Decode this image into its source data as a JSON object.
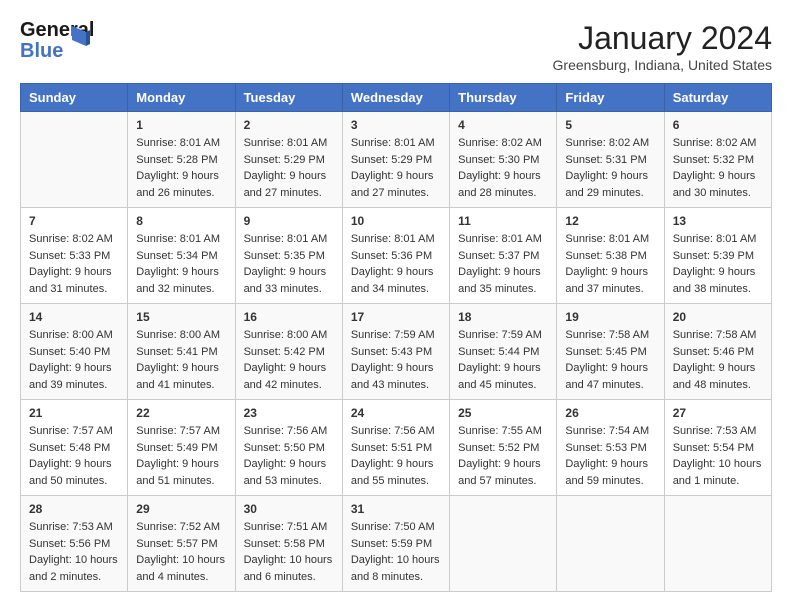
{
  "header": {
    "logo_line1": "General",
    "logo_line2": "Blue",
    "title": "January 2024",
    "subtitle": "Greensburg, Indiana, United States"
  },
  "calendar": {
    "headers": [
      "Sunday",
      "Monday",
      "Tuesday",
      "Wednesday",
      "Thursday",
      "Friday",
      "Saturday"
    ],
    "rows": [
      [
        {
          "day": "",
          "sunrise": "",
          "sunset": "",
          "daylight": ""
        },
        {
          "day": "1",
          "sunrise": "Sunrise: 8:01 AM",
          "sunset": "Sunset: 5:28 PM",
          "daylight": "Daylight: 9 hours and 26 minutes."
        },
        {
          "day": "2",
          "sunrise": "Sunrise: 8:01 AM",
          "sunset": "Sunset: 5:29 PM",
          "daylight": "Daylight: 9 hours and 27 minutes."
        },
        {
          "day": "3",
          "sunrise": "Sunrise: 8:01 AM",
          "sunset": "Sunset: 5:29 PM",
          "daylight": "Daylight: 9 hours and 27 minutes."
        },
        {
          "day": "4",
          "sunrise": "Sunrise: 8:02 AM",
          "sunset": "Sunset: 5:30 PM",
          "daylight": "Daylight: 9 hours and 28 minutes."
        },
        {
          "day": "5",
          "sunrise": "Sunrise: 8:02 AM",
          "sunset": "Sunset: 5:31 PM",
          "daylight": "Daylight: 9 hours and 29 minutes."
        },
        {
          "day": "6",
          "sunrise": "Sunrise: 8:02 AM",
          "sunset": "Sunset: 5:32 PM",
          "daylight": "Daylight: 9 hours and 30 minutes."
        }
      ],
      [
        {
          "day": "7",
          "sunrise": "Sunrise: 8:02 AM",
          "sunset": "Sunset: 5:33 PM",
          "daylight": "Daylight: 9 hours and 31 minutes."
        },
        {
          "day": "8",
          "sunrise": "Sunrise: 8:01 AM",
          "sunset": "Sunset: 5:34 PM",
          "daylight": "Daylight: 9 hours and 32 minutes."
        },
        {
          "day": "9",
          "sunrise": "Sunrise: 8:01 AM",
          "sunset": "Sunset: 5:35 PM",
          "daylight": "Daylight: 9 hours and 33 minutes."
        },
        {
          "day": "10",
          "sunrise": "Sunrise: 8:01 AM",
          "sunset": "Sunset: 5:36 PM",
          "daylight": "Daylight: 9 hours and 34 minutes."
        },
        {
          "day": "11",
          "sunrise": "Sunrise: 8:01 AM",
          "sunset": "Sunset: 5:37 PM",
          "daylight": "Daylight: 9 hours and 35 minutes."
        },
        {
          "day": "12",
          "sunrise": "Sunrise: 8:01 AM",
          "sunset": "Sunset: 5:38 PM",
          "daylight": "Daylight: 9 hours and 37 minutes."
        },
        {
          "day": "13",
          "sunrise": "Sunrise: 8:01 AM",
          "sunset": "Sunset: 5:39 PM",
          "daylight": "Daylight: 9 hours and 38 minutes."
        }
      ],
      [
        {
          "day": "14",
          "sunrise": "Sunrise: 8:00 AM",
          "sunset": "Sunset: 5:40 PM",
          "daylight": "Daylight: 9 hours and 39 minutes."
        },
        {
          "day": "15",
          "sunrise": "Sunrise: 8:00 AM",
          "sunset": "Sunset: 5:41 PM",
          "daylight": "Daylight: 9 hours and 41 minutes."
        },
        {
          "day": "16",
          "sunrise": "Sunrise: 8:00 AM",
          "sunset": "Sunset: 5:42 PM",
          "daylight": "Daylight: 9 hours and 42 minutes."
        },
        {
          "day": "17",
          "sunrise": "Sunrise: 7:59 AM",
          "sunset": "Sunset: 5:43 PM",
          "daylight": "Daylight: 9 hours and 43 minutes."
        },
        {
          "day": "18",
          "sunrise": "Sunrise: 7:59 AM",
          "sunset": "Sunset: 5:44 PM",
          "daylight": "Daylight: 9 hours and 45 minutes."
        },
        {
          "day": "19",
          "sunrise": "Sunrise: 7:58 AM",
          "sunset": "Sunset: 5:45 PM",
          "daylight": "Daylight: 9 hours and 47 minutes."
        },
        {
          "day": "20",
          "sunrise": "Sunrise: 7:58 AM",
          "sunset": "Sunset: 5:46 PM",
          "daylight": "Daylight: 9 hours and 48 minutes."
        }
      ],
      [
        {
          "day": "21",
          "sunrise": "Sunrise: 7:57 AM",
          "sunset": "Sunset: 5:48 PM",
          "daylight": "Daylight: 9 hours and 50 minutes."
        },
        {
          "day": "22",
          "sunrise": "Sunrise: 7:57 AM",
          "sunset": "Sunset: 5:49 PM",
          "daylight": "Daylight: 9 hours and 51 minutes."
        },
        {
          "day": "23",
          "sunrise": "Sunrise: 7:56 AM",
          "sunset": "Sunset: 5:50 PM",
          "daylight": "Daylight: 9 hours and 53 minutes."
        },
        {
          "day": "24",
          "sunrise": "Sunrise: 7:56 AM",
          "sunset": "Sunset: 5:51 PM",
          "daylight": "Daylight: 9 hours and 55 minutes."
        },
        {
          "day": "25",
          "sunrise": "Sunrise: 7:55 AM",
          "sunset": "Sunset: 5:52 PM",
          "daylight": "Daylight: 9 hours and 57 minutes."
        },
        {
          "day": "26",
          "sunrise": "Sunrise: 7:54 AM",
          "sunset": "Sunset: 5:53 PM",
          "daylight": "Daylight: 9 hours and 59 minutes."
        },
        {
          "day": "27",
          "sunrise": "Sunrise: 7:53 AM",
          "sunset": "Sunset: 5:54 PM",
          "daylight": "Daylight: 10 hours and 1 minute."
        }
      ],
      [
        {
          "day": "28",
          "sunrise": "Sunrise: 7:53 AM",
          "sunset": "Sunset: 5:56 PM",
          "daylight": "Daylight: 10 hours and 2 minutes."
        },
        {
          "day": "29",
          "sunrise": "Sunrise: 7:52 AM",
          "sunset": "Sunset: 5:57 PM",
          "daylight": "Daylight: 10 hours and 4 minutes."
        },
        {
          "day": "30",
          "sunrise": "Sunrise: 7:51 AM",
          "sunset": "Sunset: 5:58 PM",
          "daylight": "Daylight: 10 hours and 6 minutes."
        },
        {
          "day": "31",
          "sunrise": "Sunrise: 7:50 AM",
          "sunset": "Sunset: 5:59 PM",
          "daylight": "Daylight: 10 hours and 8 minutes."
        },
        {
          "day": "",
          "sunrise": "",
          "sunset": "",
          "daylight": ""
        },
        {
          "day": "",
          "sunrise": "",
          "sunset": "",
          "daylight": ""
        },
        {
          "day": "",
          "sunrise": "",
          "sunset": "",
          "daylight": ""
        }
      ]
    ]
  }
}
